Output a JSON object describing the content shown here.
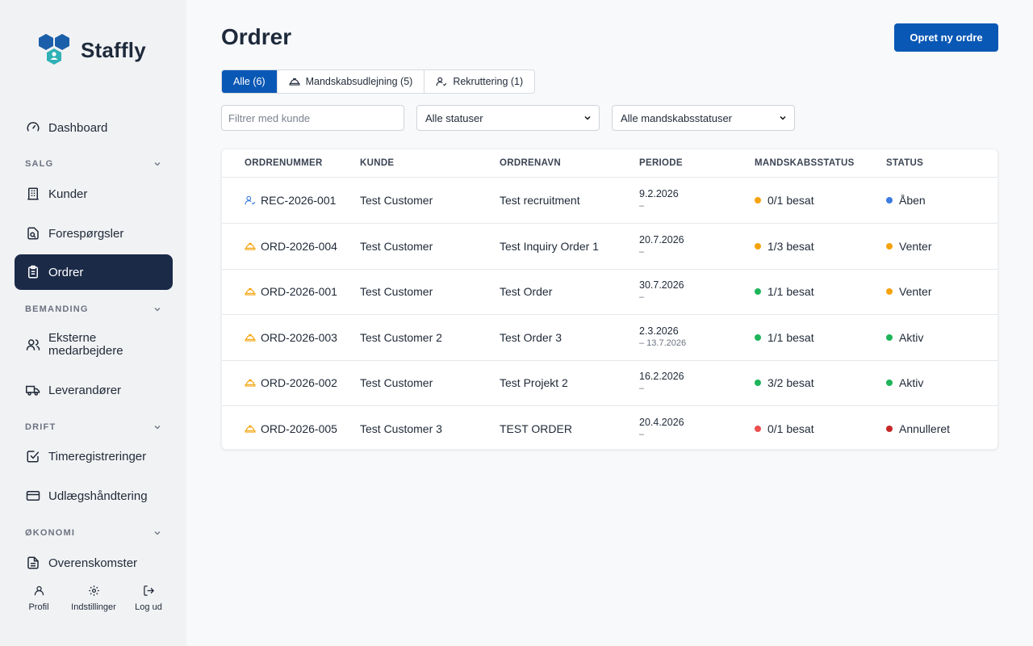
{
  "app": {
    "brand": "Staffly"
  },
  "sidebar": {
    "dashboard": "Dashboard",
    "sections": {
      "salg": "SALG",
      "bemanding": "BEMANDING",
      "drift": "DRIFT",
      "okonomi": "ØKONOMI"
    },
    "items": {
      "kunder": "Kunder",
      "foresporgsler": "Forespørgsler",
      "ordrer": "Ordrer",
      "eksterne_line1": "Eksterne",
      "eksterne_line2": "medarbejdere",
      "leverandorer": "Leverandører",
      "timeregistreringer": "Timeregistreringer",
      "udlaeg": "Udlægshåndtering",
      "overenskomster": "Overenskomster"
    },
    "bottom": {
      "profil": "Profil",
      "indstillinger": "Indstillinger",
      "logud": "Log ud"
    }
  },
  "main": {
    "title": "Ordrer",
    "create_button": "Opret ny ordre",
    "tabs": [
      {
        "label": "Alle (6)",
        "active": true
      },
      {
        "label": "Mandskabsudlejning (5)",
        "icon": "hard-hat-icon"
      },
      {
        "label": "Rekruttering (1)",
        "icon": "user-check-icon"
      }
    ],
    "filter_placeholder": "Filtrer med kunde",
    "status_select": "Alle statuser",
    "crew_status_select": "Alle mandskabsstatuser"
  },
  "table": {
    "headers": {
      "ordrenummer": "ORDRENUMMER",
      "kunde": "KUNDE",
      "ordrenavn": "ORDRENAVN",
      "periode": "PERIODE",
      "mandskabsstatus": "MANDSKABSSTATUS",
      "status": "STATUS"
    },
    "rows": [
      {
        "type": "recruitment",
        "order_no": "REC-2026-001",
        "customer": "Test Customer",
        "name": "Test recruitment",
        "start": "9.2.2026",
        "end": "–",
        "crew": "0/1 besat",
        "crew_color": "#f5a30b",
        "status": "Åben",
        "status_color": "#3b7be0"
      },
      {
        "type": "staffing",
        "order_no": "ORD-2026-004",
        "customer": "Test Customer",
        "name": "Test Inquiry Order 1",
        "start": "20.7.2026",
        "end": "–",
        "crew": "1/3 besat",
        "crew_color": "#f5a30b",
        "status": "Venter",
        "status_color": "#f5a30b"
      },
      {
        "type": "staffing",
        "order_no": "ORD-2026-001",
        "customer": "Test Customer",
        "name": "Test Order",
        "start": "30.7.2026",
        "end": "–",
        "crew": "1/1 besat",
        "crew_color": "#1fb45a",
        "status": "Venter",
        "status_color": "#f5a30b"
      },
      {
        "type": "staffing",
        "order_no": "ORD-2026-003",
        "customer": "Test Customer 2",
        "name": "Test Order 3",
        "start": "2.3.2026",
        "end": "– 13.7.2026",
        "crew": "1/1 besat",
        "crew_color": "#1fb45a",
        "status": "Aktiv",
        "status_color": "#1fb45a"
      },
      {
        "type": "staffing",
        "order_no": "ORD-2026-002",
        "customer": "Test Customer",
        "name": "Test Projekt 2",
        "start": "16.2.2026",
        "end": "–",
        "crew": "3/2 besat",
        "crew_color": "#1fb45a",
        "status": "Aktiv",
        "status_color": "#1fb45a"
      },
      {
        "type": "staffing",
        "order_no": "ORD-2026-005",
        "customer": "Test Customer 3",
        "name": "TEST ORDER",
        "start": "20.4.2026",
        "end": "–",
        "crew": "0/1 besat",
        "crew_color": "#ec4f4f",
        "status": "Annulleret",
        "status_color": "#c62828"
      }
    ]
  }
}
